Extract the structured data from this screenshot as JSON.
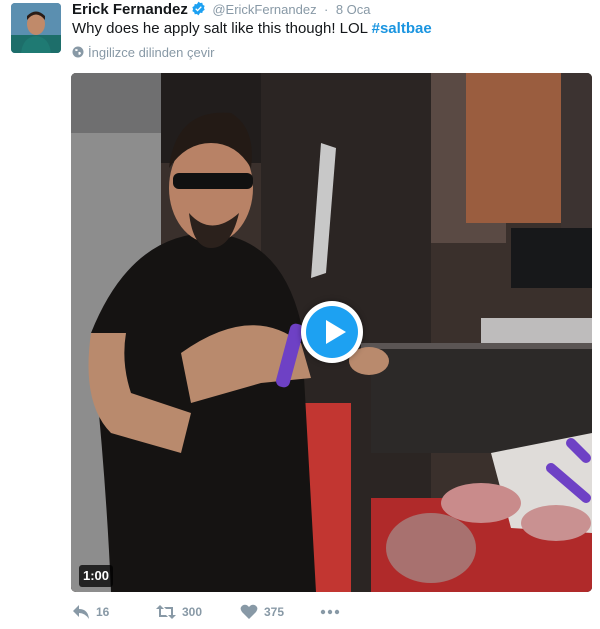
{
  "tweet": {
    "author": {
      "name": "Erick Fernandez",
      "handle": "@ErickFernandez",
      "separator": "·",
      "time": "8 Oca"
    },
    "text_prefix": "Why does he apply salt like this though! LOL ",
    "hashtag": "#saltbae",
    "translate_label": "İngilizce dilinden çevir",
    "video": {
      "duration": "1:00"
    },
    "actions": {
      "reply_count": "16",
      "retweet_count": "300",
      "like_count": "375"
    },
    "colors": {
      "link": "#1b95e0",
      "play": "#1da1f2",
      "muted": "#8899a6"
    },
    "icons": [
      "verified-badge-icon",
      "globe-icon",
      "play-icon",
      "reply-icon",
      "retweet-icon",
      "heart-icon",
      "more-icon"
    ]
  }
}
